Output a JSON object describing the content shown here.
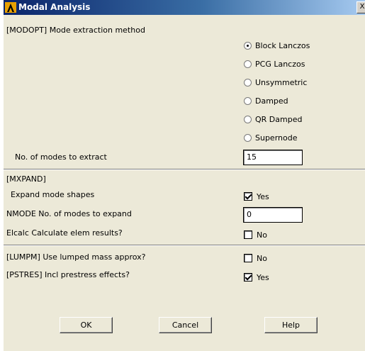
{
  "window": {
    "title": "Modal Analysis",
    "close_glyph": "X"
  },
  "modopt": {
    "label": "[MODOPT] Mode extraction method",
    "options": [
      {
        "label": "Block Lanczos",
        "selected": true
      },
      {
        "label": "PCG Lanczos",
        "selected": false
      },
      {
        "label": "Unsymmetric",
        "selected": false
      },
      {
        "label": "Damped",
        "selected": false
      },
      {
        "label": "QR Damped",
        "selected": false
      },
      {
        "label": "Supernode",
        "selected": false
      }
    ],
    "nmodes_label": "No. of modes to extract",
    "nmodes_value": "15"
  },
  "mxpand": {
    "label": "[MXPAND]",
    "expand_label": "Expand mode shapes",
    "expand_value": "Yes",
    "expand_checked": true,
    "nmode_label": "NMODE No. of modes to expand",
    "nmode_value": "0",
    "elcalc_label": "Elcalc  Calculate elem results?",
    "elcalc_value": "No",
    "elcalc_checked": false
  },
  "lumpm": {
    "label": "[LUMPM]  Use lumped mass approx?",
    "value": "No",
    "checked": false
  },
  "pstres": {
    "label": "[PSTRES] Incl prestress effects?",
    "value": "Yes",
    "checked": true
  },
  "buttons": {
    "ok": "OK",
    "cancel": "Cancel",
    "help": "Help"
  }
}
